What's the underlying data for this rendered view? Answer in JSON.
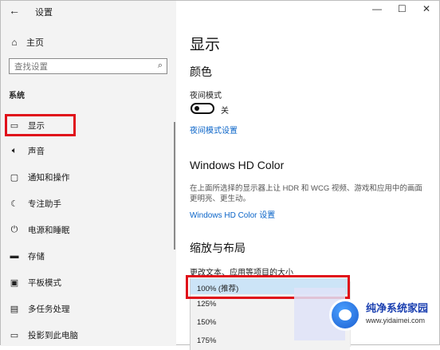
{
  "window": {
    "app_title": "设置",
    "controls": {
      "minimize": "—",
      "maximize": "☐",
      "close": "✕"
    }
  },
  "sidebar": {
    "back_icon": "←",
    "home_label": "主页",
    "search_placeholder": "查找设置",
    "section_label": "系统",
    "items": [
      {
        "label": "显示",
        "icon": "monitor-icon"
      },
      {
        "label": "声音",
        "icon": "speaker-icon"
      },
      {
        "label": "通知和操作",
        "icon": "notification-icon"
      },
      {
        "label": "专注助手",
        "icon": "moon-icon"
      },
      {
        "label": "电源和睡眠",
        "icon": "power-icon"
      },
      {
        "label": "存储",
        "icon": "storage-icon"
      },
      {
        "label": "平板模式",
        "icon": "tablet-icon"
      },
      {
        "label": "多任务处理",
        "icon": "multitask-icon"
      },
      {
        "label": "投影到此电脑",
        "icon": "project-icon"
      }
    ]
  },
  "main": {
    "title": "显示",
    "color": {
      "heading": "颜色",
      "night_light_label": "夜间模式",
      "toggle_state": "关",
      "settings_link": "夜间模式设置"
    },
    "hd_color": {
      "heading": "Windows HD Color",
      "description": "在上面所选择的显示器上让 HDR 和 WCG 视频、游戏和应用中的画面更明亮、更生动。",
      "link": "Windows HD Color 设置"
    },
    "scale": {
      "heading": "缩放与布局",
      "label": "更改文本、应用等项目的大小",
      "options": [
        "100% (推荐)",
        "125%",
        "150%",
        "175%"
      ],
      "selected_index": 0
    }
  },
  "watermark": {
    "title": "纯净系统家园",
    "url": "www.yidaimei.com"
  },
  "colors": {
    "highlight_red": "#e0101a",
    "link_blue": "#0a64c8",
    "selected_option": "#cce4f7",
    "sidebar_bg": "#f3f3f3"
  }
}
